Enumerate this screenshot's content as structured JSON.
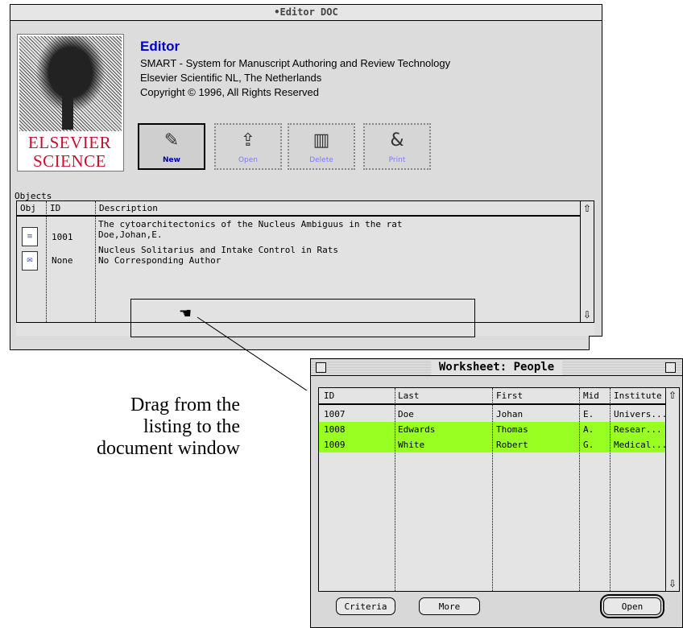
{
  "editor": {
    "title": "•Editor DOC",
    "logo": {
      "line1": "ELSEVIER",
      "line2": "SCIENCE"
    },
    "app_title": "Editor",
    "info": [
      "SMART - System for Manuscript Authoring and Review Technology",
      "Elsevier Scientific NL, The Netherlands",
      "Copyright © 1996, All Rights Reserved"
    ],
    "toolbar": [
      {
        "label": "New",
        "icon": "new-document-icon"
      },
      {
        "label": "Open",
        "icon": "open-folder-icon"
      },
      {
        "label": "Delete",
        "icon": "trash-icon"
      },
      {
        "label": "Print",
        "icon": "printer-icon"
      }
    ],
    "objects_label": "Objects",
    "columns": [
      "Obj",
      "ID",
      "Description"
    ],
    "rows": [
      {
        "icon": "document-icon",
        "id": "1001",
        "description": [
          "The cytoarchitectonics of the Nucleus Ambiguus in the rat",
          "Doe,Johan,E."
        ]
      },
      {
        "icon": "envelope-document-icon",
        "id": "None",
        "description": [
          "Nucleus Solitarius and Intake Control in Rats",
          "No Corresponding Author"
        ]
      }
    ]
  },
  "caption": [
    "Drag from the",
    "listing to the",
    "document window"
  ],
  "worksheet": {
    "title": "Worksheet: People",
    "columns": [
      "ID",
      "Last",
      "First",
      "Mid",
      "Institute"
    ],
    "rows": [
      {
        "id": "1007",
        "last": "Doe",
        "first": "Johan",
        "mid": "E.",
        "institute": "Univers...",
        "highlighted": false
      },
      {
        "id": "1008",
        "last": "Edwards",
        "first": "Thomas",
        "mid": "A.",
        "institute": "Resear...",
        "highlighted": true
      },
      {
        "id": "1009",
        "last": "White",
        "first": "Robert",
        "mid": "G.",
        "institute": "Medical...",
        "highlighted": true
      }
    ],
    "highlight_color": "#99ff22",
    "buttons": {
      "criteria": "Criteria",
      "more": "More",
      "open": "Open"
    }
  }
}
